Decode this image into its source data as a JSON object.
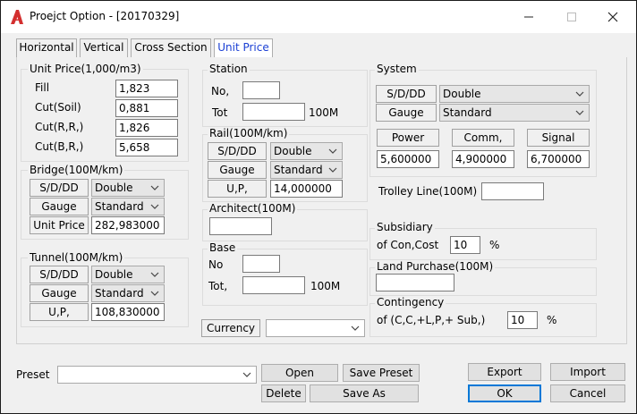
{
  "window": {
    "title": "Proejct Option - [20170329]"
  },
  "tabs": [
    "Horizontal",
    "Vertical",
    "Cross Section",
    "Unit Price"
  ],
  "unit_price": {
    "title": "Unit Price(1,000/m3)",
    "rows": [
      {
        "label": "Fill",
        "value": "1,823"
      },
      {
        "label": "Cut(Soil)",
        "value": "0,881"
      },
      {
        "label": "Cut(R,R,)",
        "value": "1,826"
      },
      {
        "label": "Cut(B,R,)",
        "value": "5,658"
      }
    ]
  },
  "bridge": {
    "title": "Bridge(100M/km)",
    "sdd_label": "S/D/DD",
    "sdd_value": "Double",
    "gauge_label": "Gauge",
    "gauge_value": "Standard",
    "up_label": "Unit Price",
    "up_value": "282,983000"
  },
  "tunnel": {
    "title": "Tunnel(100M/km)",
    "sdd_label": "S/D/DD",
    "sdd_value": "Double",
    "gauge_label": "Gauge",
    "gauge_value": "Standard",
    "up_label": "U,P,",
    "up_value": "108,830000"
  },
  "station": {
    "title": "Station",
    "no_label": "No,",
    "no_value": "",
    "tot_label": "Tot",
    "tot_value": "",
    "unit": "100M"
  },
  "rail": {
    "title": "Rail(100M/km)",
    "sdd_label": "S/D/DD",
    "sdd_value": "Double",
    "gauge_label": "Gauge",
    "gauge_value": "Standard",
    "up_label": "U,P,",
    "up_value": "14,000000"
  },
  "architect": {
    "title": "Architect(100M)",
    "value": ""
  },
  "base": {
    "title": "Base",
    "no_label": "No",
    "no_value": "",
    "tot_label": "Tot,",
    "tot_value": "",
    "unit": "100M"
  },
  "currency": {
    "label": "Currency",
    "value": ""
  },
  "system": {
    "title": "System",
    "sdd_label": "S/D/DD",
    "sdd_value": "Double",
    "gauge_label": "Gauge",
    "gauge_value": "Standard",
    "power_label": "Power",
    "power_value": "5,600000",
    "comm_label": "Comm,",
    "comm_value": "4,900000",
    "signal_label": "Signal",
    "signal_value": "6,700000",
    "trolley_label": "Trolley Line(100M)",
    "trolley_value": ""
  },
  "subsidiary": {
    "title": "Subsidiary",
    "label": "of Con,Cost",
    "value": "10",
    "unit": "%"
  },
  "land": {
    "title": "Land Purchase(100M)",
    "value": ""
  },
  "contingency": {
    "title": "Contingency",
    "label": "of (C,C,+L,P,+ Sub,)",
    "value": "10",
    "unit": "%"
  },
  "preset": {
    "label": "Preset",
    "value": ""
  },
  "buttons": {
    "open": "Open",
    "save_preset": "Save Preset",
    "delete": "Delete",
    "save_as": "Save As",
    "export": "Export",
    "import": "Import",
    "ok": "OK",
    "cancel": "Cancel"
  },
  "colors": {
    "active_tab_text": "#1a3fd4",
    "default_button_border": "#0078d7",
    "app_icon": "#d32f2f"
  }
}
